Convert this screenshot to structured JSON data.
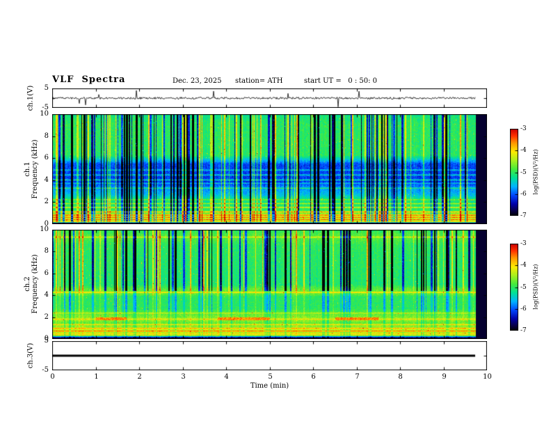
{
  "title": "VLF  Spectra",
  "header": {
    "date": "Dec. 23, 2025",
    "station": "station= ATH",
    "start_ut": "start UT =   0 : 50: 0"
  },
  "panels": {
    "ch1_wave": {
      "label": "ch.1(V)",
      "yticks": [
        "5",
        "-5"
      ]
    },
    "spec1": {
      "label_channel": "ch.1",
      "label_axis": "Frequency (kHz)",
      "yticks": [
        "10",
        "8",
        "6",
        "4",
        "2",
        "0"
      ]
    },
    "spec2": {
      "label_channel": "ch.2",
      "label_axis": "Frequency (kHz)",
      "yticks": [
        "10",
        "8",
        "6",
        "4",
        "2",
        "0"
      ]
    },
    "ch3_wave": {
      "label": "ch.3(V)",
      "yticks": [
        "5",
        "-5"
      ]
    }
  },
  "xaxis": {
    "label": "Time (min)",
    "ticks": [
      "0",
      "1",
      "2",
      "3",
      "4",
      "5",
      "6",
      "7",
      "8",
      "9",
      "10"
    ]
  },
  "colorbars": [
    {
      "label": "log(PSD)(V²/Hz)",
      "ticks": [
        "-3",
        "-4",
        "-5",
        "-6",
        "-7"
      ]
    },
    {
      "label": "log(PSD)(V²/Hz)",
      "ticks": [
        "-3",
        "-4",
        "-5",
        "-6",
        "-7"
      ]
    }
  ],
  "chart_data": [
    {
      "type": "line",
      "name": "ch.1 (V) waveform",
      "xlabel": "Time (min)",
      "xlim": [
        0,
        10
      ],
      "ylabel": "ch.1(V)",
      "ylim": [
        -5,
        5
      ],
      "data_end_min": 9.75,
      "description": "Continuous broadband noise trace centered on 0 V (about ±1 V) with frequent impulsive spikes reaching roughly ±2 to ±4 V throughout the record."
    },
    {
      "type": "heatmap",
      "name": "ch.1 spectrogram",
      "xlabel": "Time (min)",
      "xlim": [
        0,
        10
      ],
      "ylabel": "Frequency (kHz)",
      "ylim": [
        0,
        10
      ],
      "zlabel": "log(PSD)(V²/Hz)",
      "zlim": [
        -7,
        -3
      ],
      "data_end_min": 9.75,
      "features": [
        "dense vertical broadband sferic streaks (dark blue/black and bright yellow-green) spanning 0-10 kHz",
        "low-power dark blue band between about 3.5 and 6 kHz (~ -6.5)",
        "green mid-level background (~ -5) from 6 to 10 kHz",
        "narrow green horizontal lines near 3.3, 4.0, 4.5 and 5.0 kHz",
        "bright yellow-orange horizontal hum lines below ~1.5 kHz (~ -3.5), some red",
        "black band at 0-0.15 kHz and black strip after data end"
      ]
    },
    {
      "type": "heatmap",
      "name": "ch.2 spectrogram",
      "xlabel": "Time (min)",
      "xlim": [
        0,
        10
      ],
      "ylabel": "Frequency (kHz)",
      "ylim": [
        0,
        10
      ],
      "zlabel": "log(PSD)(V²/Hz)",
      "zlim": [
        -7,
        -3
      ],
      "data_end_min": 9.75,
      "features": [
        "green background (~ -4.5) with dark blue vertical sferic streaks mainly above 4.5 kHz",
        "bright horizontal line near 4.3 kHz and near 9.3 kHz",
        "yellow horizontal banding between 0.5 and 2.5 kHz",
        "intermittent red-brown segments near 1.8 kHz around 1-1.7, 3.8-5.0 and 6.5-7.5 min",
        "black band at 0-0.15 kHz and black strip after data end"
      ]
    },
    {
      "type": "line",
      "name": "ch.3 (V) waveform",
      "xlabel": "Time (min)",
      "xlim": [
        0,
        10
      ],
      "ylabel": "ch.3(V)",
      "ylim": [
        -5,
        5
      ],
      "data_end_min": 9.72,
      "description": "Flat thick black trace at 0 V for the whole record (no signal on channel 3)."
    }
  ]
}
